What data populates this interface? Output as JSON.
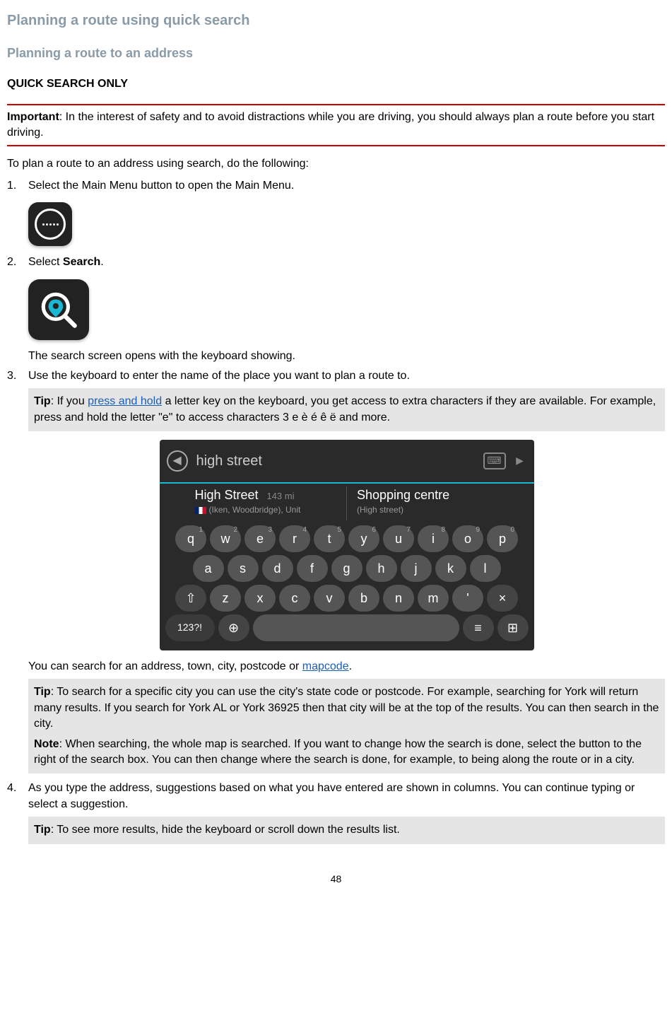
{
  "headings": {
    "h1": "Planning a route using quick search",
    "h2": "Planning a route to an address",
    "h3": "QUICK SEARCH ONLY"
  },
  "important": {
    "label": "Important",
    "text": ": In the interest of safety and to avoid distractions while you are driving, you should always plan a route before you start driving."
  },
  "intro": "To plan a route to an address using search, do the following:",
  "steps": {
    "s1": "Select the Main Menu button to open the Main Menu.",
    "s2_prefix": "Select ",
    "s2_bold": "Search",
    "s2_suffix": ".",
    "s2_after": "The search screen opens with the keyboard showing.",
    "s3": "Use the keyboard to enter the name of the place you want to plan a route to.",
    "s3_after_prefix": "You can search for an address, town, city, postcode or ",
    "s3_after_link": "mapcode",
    "s3_after_suffix": ".",
    "s4": "As you type the address, suggestions based on what you have entered are shown in columns. You can continue typing or select a suggestion."
  },
  "tips": {
    "tip1_label": "Tip",
    "tip1_prefix": ": If you ",
    "tip1_link": "press and hold",
    "tip1_suffix": " a letter key on the keyboard, you get access to extra characters if they are available. For example, press and hold the letter \"e\" to access characters 3 e è é ê ë and more.",
    "tip2_label": "Tip",
    "tip2_text": ": To search for a specific city you can use the city's state code or postcode. For example, searching for York will return many results. If you search for York AL or York 36925 then that city will be at the top of the results. You can then search in the city.",
    "note2_label": "Note",
    "note2_text": ": When searching, the whole map is searched. If you want to change how the search is done, select the button to the right of the search box. You can then change where the search is done, for example, to being along the route or in a city.",
    "tip3_label": "Tip",
    "tip3_text": ": To see more results, hide the keyboard or scroll down the results list."
  },
  "keyboard": {
    "search_text": "high street",
    "result1_title": "High Street",
    "result1_dist": "143",
    "result1_unit": "mi",
    "result1_sub": "(Iken, Woodbridge), Unit",
    "result2_title": "Shopping centre",
    "result2_sub": "(High street)",
    "row1": [
      "q",
      "w",
      "e",
      "r",
      "t",
      "y",
      "u",
      "i",
      "o",
      "p"
    ],
    "row1_sup": [
      "1",
      "2",
      "3",
      "4",
      "5",
      "6",
      "7",
      "8",
      "9",
      "0"
    ],
    "row2": [
      "a",
      "s",
      "d",
      "f",
      "g",
      "h",
      "j",
      "k",
      "l"
    ],
    "row3_shift": "⇧",
    "row3": [
      "z",
      "x",
      "c",
      "v",
      "b",
      "n",
      "m",
      "'"
    ],
    "row3_del": "×",
    "row4_mode": "123?!",
    "row4_globe": "🌐",
    "row4_menu": "≡",
    "row4_done": "⊕"
  },
  "page_number": "48"
}
